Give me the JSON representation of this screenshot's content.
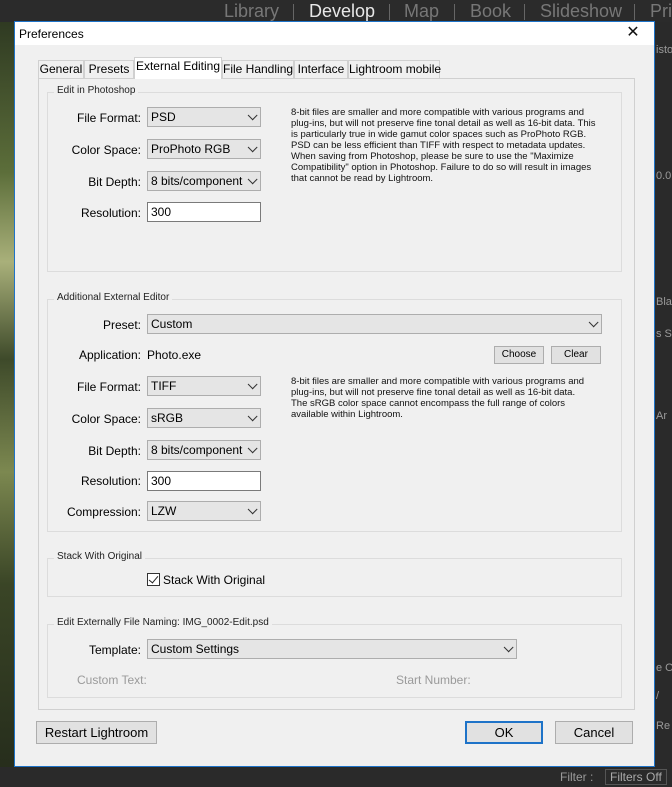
{
  "lightroom": {
    "modules": [
      "Library",
      "Develop",
      "Map",
      "Book",
      "Slideshow",
      "Pri"
    ],
    "active_module": "Develop",
    "right_panel_fragments": [
      "isto",
      "0.0",
      "Blac",
      "s Sh",
      "Ar",
      "/",
      "e O",
      "Re"
    ],
    "filter_label": "Filter :",
    "filter_value": "Filters Off"
  },
  "dialog": {
    "title": "Preferences",
    "tabs": [
      "General",
      "Presets",
      "External Editing",
      "File Handling",
      "Interface",
      "Lightroom mobile"
    ],
    "active_tab": "External Editing",
    "photoshop": {
      "group_label": "Edit in Photoshop",
      "file_format_label": "File Format:",
      "file_format": "PSD",
      "color_space_label": "Color Space:",
      "color_space": "ProPhoto RGB",
      "bit_depth_label": "Bit Depth:",
      "bit_depth": "8 bits/component",
      "resolution_label": "Resolution:",
      "resolution": "300",
      "description": "8-bit files are smaller and more compatible with various programs and plug-ins, but will not preserve fine tonal detail as well as 16-bit data. This is particularly true in wide gamut color spaces such as ProPhoto RGB. PSD can be less efficient than TIFF with respect to metadata updates. When saving from Photoshop, please be sure to use the \"Maximize Compatibility\" option in Photoshop. Failure to do so will result in images that cannot be read by Lightroom."
    },
    "additional": {
      "group_label": "Additional External Editor",
      "preset_label": "Preset:",
      "preset": "Custom",
      "application_label": "Application:",
      "application": "Photo.exe",
      "choose_label": "Choose",
      "clear_label": "Clear",
      "file_format_label": "File Format:",
      "file_format": "TIFF",
      "color_space_label": "Color Space:",
      "color_space": "sRGB",
      "bit_depth_label": "Bit Depth:",
      "bit_depth": "8 bits/component",
      "resolution_label": "Resolution:",
      "resolution": "300",
      "compression_label": "Compression:",
      "compression": "LZW",
      "description": "8-bit files are smaller and more compatible with various programs and plug-ins, but will not preserve fine tonal detail as well as 16-bit data. The sRGB color space cannot encompass the full range of colors available within Lightroom."
    },
    "stack": {
      "group_label": "Stack With Original",
      "checkbox_label": "Stack With Original",
      "checked": true
    },
    "naming": {
      "group_label": "Edit Externally File Naming:  IMG_0002-Edit.psd",
      "template_label": "Template:",
      "template": "Custom Settings",
      "custom_text_label": "Custom Text:",
      "start_number_label": "Start Number:"
    },
    "buttons": {
      "restart": "Restart Lightroom",
      "ok": "OK",
      "cancel": "Cancel"
    }
  }
}
